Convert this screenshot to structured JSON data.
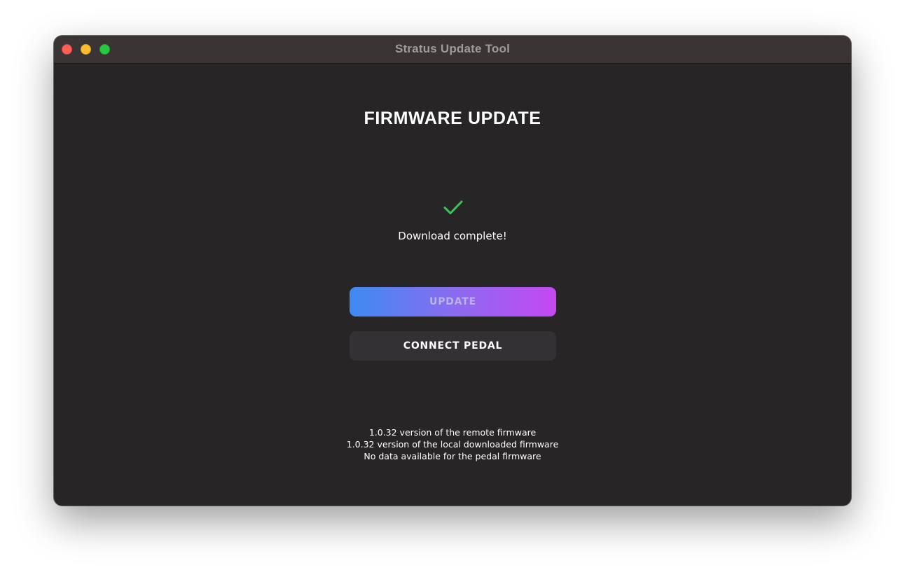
{
  "window": {
    "title": "Stratus Update Tool"
  },
  "main": {
    "heading": "FIRMWARE UPDATE",
    "status_icon": "checkmark-icon",
    "status_text": "Download complete!",
    "update_button_label": "UPDATE",
    "connect_button_label": "CONNECT PEDAL",
    "versions": [
      "1.0.32 version of the remote firmware",
      "1.0.32 version of the local downloaded firmware",
      "No data available for the pedal firmware"
    ]
  },
  "colors": {
    "success": "#37c65a",
    "gradient_start": "#3d8bf2",
    "gradient_end": "#c548f2",
    "window_background": "#282527",
    "titlebar_background": "#3a3534"
  }
}
